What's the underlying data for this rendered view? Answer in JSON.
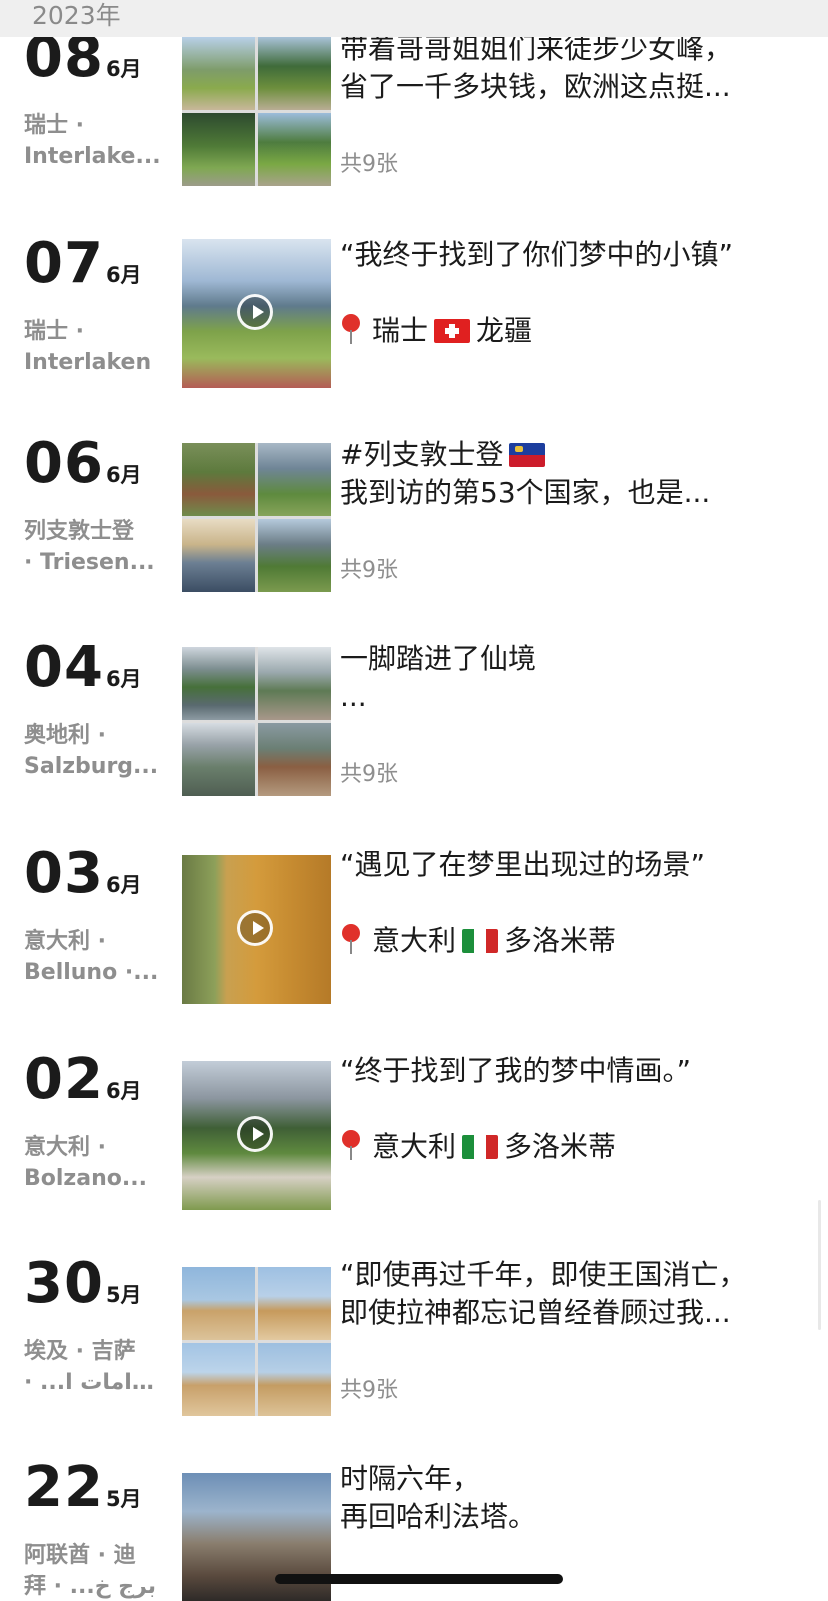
{
  "year_label": "2023年",
  "entries": [
    {
      "day": "08",
      "month": "6月",
      "loc1": "瑞士 ·",
      "loc2": "Interlake...",
      "line1": "带着哥哥姐姐们来徒步少女峰，",
      "line2": "省了一千多块钱，欧洲这点挺...",
      "count": "共9张"
    },
    {
      "day": "07",
      "month": "6月",
      "loc1": "瑞士 ·",
      "loc2": "Interlaken",
      "line1": "“我终于找到了你们梦中的小镇”",
      "pin_a": "瑞士",
      "flag": "switzerland-flag-icon",
      "pin_b": "龙疆"
    },
    {
      "day": "06",
      "month": "6月",
      "loc1": "列支敦士登",
      "loc2": "· Triesen...",
      "line1": "#列支敦士登",
      "flag": "liechtenstein-flag-icon",
      "line2": "我到访的第53个国家，也是...",
      "count": "共9张"
    },
    {
      "day": "04",
      "month": "6月",
      "loc1": "奥地利 ·",
      "loc2": "Salzburg...",
      "line1": "一脚踏进了仙境",
      "line2": "...",
      "count": "共9张"
    },
    {
      "day": "03",
      "month": "6月",
      "loc1": "意大利 ·",
      "loc2": "Belluno ·...",
      "line1": "“遇见了在梦里出现过的场景”",
      "pin_a": "意大利",
      "flag": "italy-flag-icon",
      "pin_b": "多洛米蒂"
    },
    {
      "day": "02",
      "month": "6月",
      "loc1": "意大利 ·",
      "loc2": "Bolzano...",
      "line1": "“终于找到了我的梦中情画。”",
      "pin_a": "意大利",
      "flag": "italy-flag-icon",
      "pin_b": "多洛米蒂"
    },
    {
      "day": "30",
      "month": "5月",
      "loc1": "埃及 · 吉萨",
      "loc2": "· ...أهرامات ا",
      "line1": "“即使再过千年，即使王国消亡，",
      "line2": "即使拉神都忘记曾经眷顾过我...",
      "count": "共9张"
    },
    {
      "day": "22",
      "month": "5月",
      "loc1": "阿联酋 · 迪",
      "loc2": "拜 · ...برج خ",
      "line1": "时隔六年，",
      "line2": "再回哈利法塔。"
    }
  ]
}
